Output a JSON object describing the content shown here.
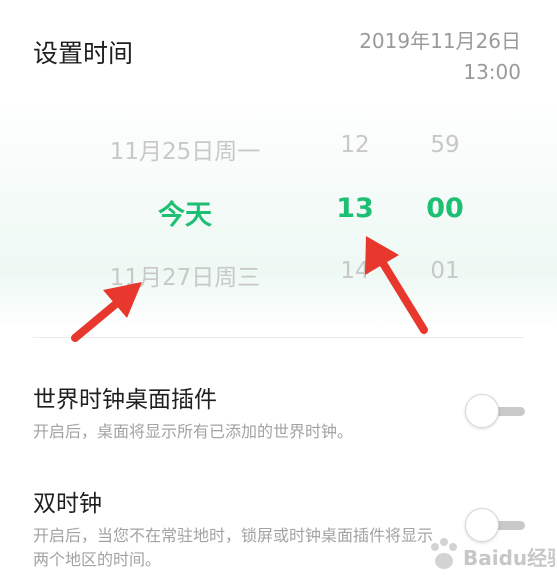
{
  "header": {
    "title": "设置时间",
    "date": "2019年11月26日",
    "time": "13:00"
  },
  "picker": {
    "date_column": {
      "prev": "11月25日周一",
      "selected": "今天",
      "next": "11月27日周三"
    },
    "hour_column": {
      "prev": "12",
      "selected": "13",
      "next": "14"
    },
    "minute_column": {
      "prev": "59",
      "selected": "00",
      "next": "01"
    },
    "accent_color": "#1dbf73"
  },
  "settings": [
    {
      "title": "世界时钟桌面插件",
      "description": "开启后，桌面将显示所有已添加的世界时钟。",
      "enabled": false
    },
    {
      "title": "双时钟",
      "description": "开启后，当您不在常驻地时，锁屏或时钟桌面插件将显示两个地区的时间。",
      "enabled": false
    }
  ],
  "annotation": {
    "arrow_color": "#e8372c"
  },
  "watermark": {
    "text": "Baidu经验"
  }
}
